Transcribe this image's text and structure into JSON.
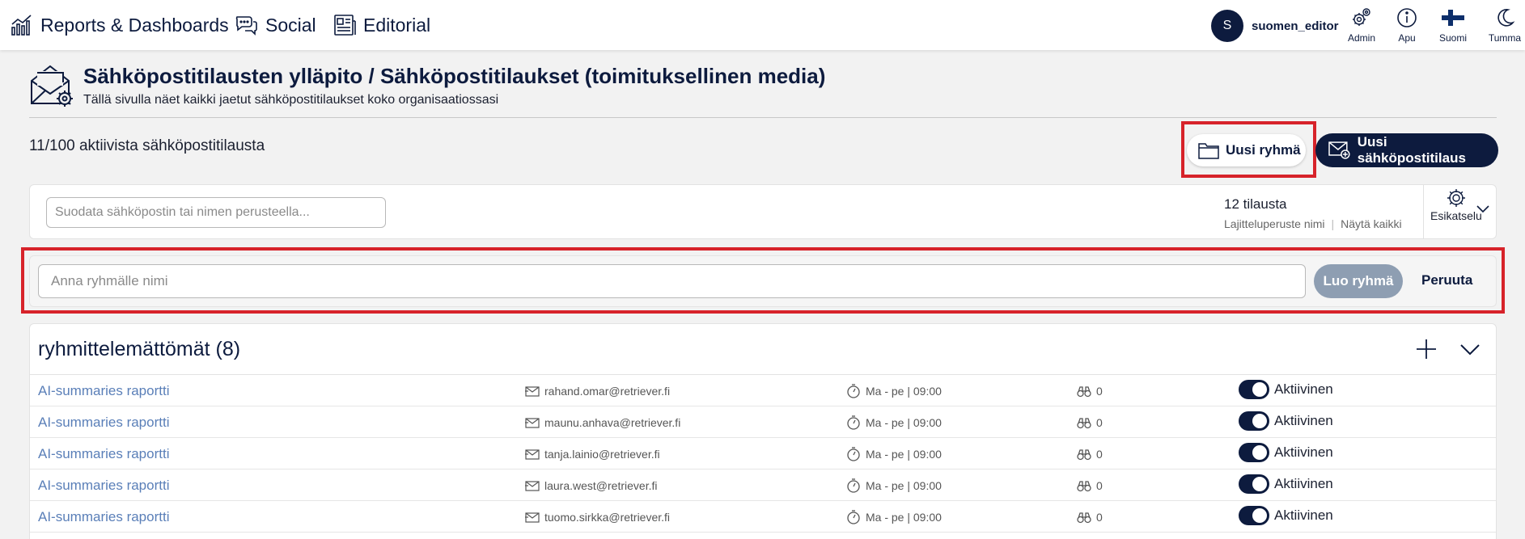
{
  "nav": {
    "items": [
      {
        "label": "Reports & Dashboards",
        "icon": "bar-chart-icon"
      },
      {
        "label": "Social",
        "icon": "chat-bubbles-icon"
      },
      {
        "label": "Editorial",
        "icon": "newspaper-icon"
      }
    ],
    "user": {
      "initial": "S",
      "name": "suomen_editor"
    },
    "tools": [
      {
        "label": "Admin",
        "icon": "gears-icon"
      },
      {
        "label": "Apu",
        "icon": "info-icon"
      },
      {
        "label": "Suomi",
        "icon": "finland-flag-icon"
      },
      {
        "label": "Tumma",
        "icon": "moon-icon"
      }
    ]
  },
  "header": {
    "title": "Sähköpostitilausten ylläpito / Sähköpostitilaukset (toimituksellinen media)",
    "subtitle": "Tällä sivulla näet kaikki jaetut sähköpostitilaukset koko organisaatiossasi"
  },
  "summary": {
    "active_count": "11/100 aktiivista sähköpostitilausta",
    "new_group_label": "Uusi ryhmä",
    "new_subscription_label": "Uusi sähköpostitilaus"
  },
  "filter": {
    "placeholder": "Suodata sähköpostin tai nimen perusteella...",
    "count_label": "12 tilausta",
    "sort_label": "Lajitteluperuste nimi",
    "show_all_label": "Näytä kaikki",
    "preview_label": "Esikatselu"
  },
  "group_form": {
    "placeholder": "Anna ryhmälle nimi",
    "create_label": "Luo ryhmä",
    "cancel_label": "Peruuta"
  },
  "list": {
    "title": "ryhmittelemättömät (8)",
    "rows": [
      {
        "name": "AI-summaries raportti",
        "email": "rahand.omar@retriever.fi",
        "schedule": "Ma - pe | 09:00",
        "count": "0",
        "status": "Aktiivinen"
      },
      {
        "name": "AI-summaries raportti",
        "email": "maunu.anhava@retriever.fi",
        "schedule": "Ma - pe | 09:00",
        "count": "0",
        "status": "Aktiivinen"
      },
      {
        "name": "AI-summaries raportti",
        "email": "tanja.lainio@retriever.fi",
        "schedule": "Ma - pe | 09:00",
        "count": "0",
        "status": "Aktiivinen"
      },
      {
        "name": "AI-summaries raportti",
        "email": "laura.west@retriever.fi",
        "schedule": "Ma - pe | 09:00",
        "count": "0",
        "status": "Aktiivinen"
      },
      {
        "name": "AI-summaries raportti",
        "email": "tuomo.sirkka@retriever.fi",
        "schedule": "Ma - pe | 09:00",
        "count": "0",
        "status": "Aktiivinen"
      }
    ]
  },
  "colors": {
    "brand": "#0d1b3e",
    "highlight": "#d7232a",
    "link": "#5a7fb8",
    "disabled_button": "#8e9eb2"
  }
}
